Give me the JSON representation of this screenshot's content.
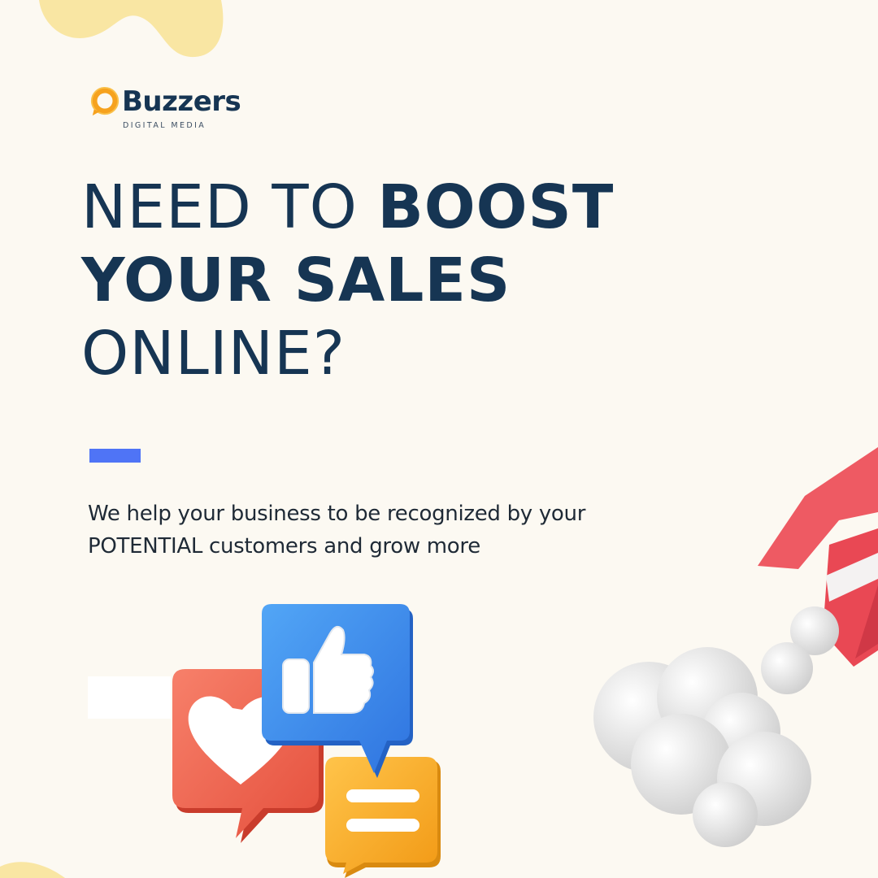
{
  "brand": {
    "name": "Buzzers",
    "tagline": "DIGITAL MEDIA"
  },
  "headline": {
    "line1_light": "NEED TO ",
    "line1_bold": "BOOST",
    "line2_bold": "YOUR SALES",
    "line3_light": "ONLINE?"
  },
  "body": {
    "text": "We help your business to be recognized by your POTENTIAL customers and grow more"
  },
  "colors": {
    "background": "#fcf9f2",
    "navy": "#163553",
    "accent_blue": "#4f74f6",
    "blob_yellow": "#f9e6a3",
    "logo_orange": "#f6a21e"
  },
  "icons": [
    "logo-mark-icon",
    "like-bubble-icon",
    "heart-bubble-icon",
    "chat-bubble-icon",
    "rocket-icon",
    "smoke-cloud-icon"
  ]
}
